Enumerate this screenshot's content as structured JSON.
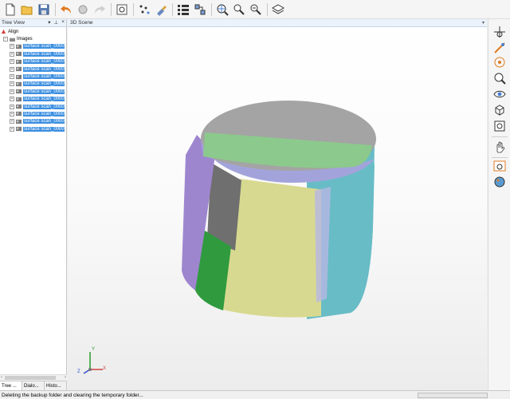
{
  "tree_view": {
    "title": "Tree View",
    "controls": [
      "▾",
      "⊥",
      "×"
    ],
    "root": "Align",
    "group": "Images",
    "items": [
      "surface scan_0000",
      "surface scan_0000",
      "surface scan_0000",
      "surface scan_0000",
      "surface scan_0000",
      "surface scan_0000",
      "surface scan_0000",
      "surface scan_0000",
      "surface scan_0000",
      "surface scan_0000",
      "surface scan_0000",
      "surface scan_0000"
    ],
    "bottom_tabs": [
      "Tree ...",
      "Dialo...",
      "Histo..."
    ]
  },
  "scene": {
    "title": "3D Scene",
    "dropdown": "▾",
    "axes": {
      "x": "X",
      "y": "Y",
      "z": "Z"
    },
    "colors": {
      "top_gray": "#a4a4a4",
      "green_band": "#8cc98c",
      "lavender": "#a3a3db",
      "purple": "#9e86cf",
      "dark_gray": "#6f6f6f",
      "green": "#2f9a3e",
      "yellow": "#d8d990",
      "cyan": "#68bcc6"
    }
  },
  "status": {
    "message": "Deleting the backup folder and clearing the temporary folder..."
  },
  "toolbar_icons": [
    "new-file-icon",
    "open-folder-icon",
    "save-icon",
    "undo-icon",
    "tools-icon",
    "redo-icon",
    "settings-icon",
    "scatter-icon",
    "paint-icon",
    "grid-icon",
    "network-icon",
    "zoom-globe-icon",
    "search-icon",
    "zoom-out-icon",
    "layers-icon"
  ],
  "right_toolbar_icons": [
    "pan-zoom-icon",
    "measure-icon",
    "target-icon",
    "zoom-fit-icon",
    "eye-icon",
    "cube-icon",
    "camera-icon",
    "hand-icon",
    "screenshot-icon",
    "palette-icon"
  ]
}
